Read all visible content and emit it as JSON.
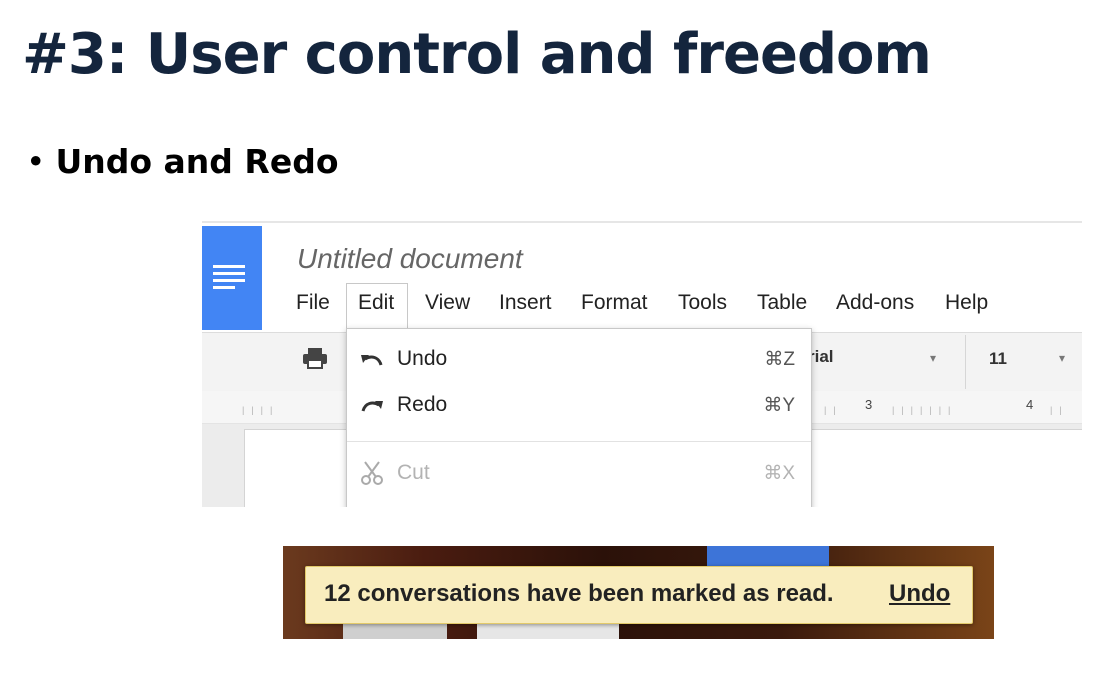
{
  "slide": {
    "title": "#3: User control and freedom",
    "bullet_marker": "•",
    "bullet": "Undo and Redo"
  },
  "docs": {
    "document_title": "Untitled document",
    "menu": [
      "File",
      "Edit",
      "View",
      "Insert",
      "Format",
      "Tools",
      "Table",
      "Add-ons",
      "Help"
    ],
    "active_menu": "Edit",
    "toolbar": {
      "font": "rial",
      "font_caret": "▾",
      "size": "11",
      "size_caret": "▾"
    },
    "ruler": {
      "mark_3": "3",
      "mark_4": "4"
    },
    "edit_menu": {
      "items": [
        {
          "label": "Undo",
          "shortcut": "⌘Z",
          "icon": "undo-icon",
          "enabled": true
        },
        {
          "label": "Redo",
          "shortcut": "⌘Y",
          "icon": "redo-icon",
          "enabled": true
        },
        {
          "label": "Cut",
          "shortcut": "⌘X",
          "icon": "scissors-icon",
          "enabled": false
        }
      ]
    },
    "colors": {
      "brand": "#4285f4"
    }
  },
  "gmail": {
    "notice": "12 conversations have been marked as read.",
    "undo_link": "Undo",
    "colors": {
      "notice_bg": "#f9edbe",
      "notice_border": "#e2c96a"
    }
  }
}
